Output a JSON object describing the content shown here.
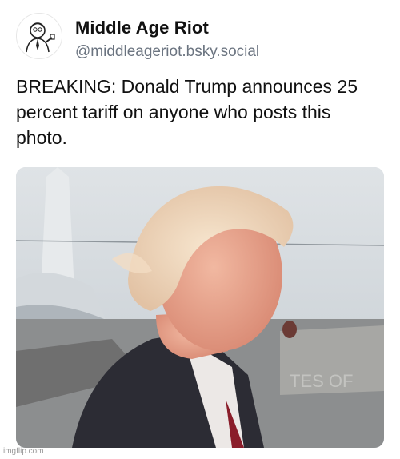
{
  "post": {
    "author": {
      "display_name": "Middle Age Riot",
      "handle": "@middleageriot.bsky.social",
      "avatar_icon": "caricature-avatar"
    },
    "text": "BREAKING: Donald Trump announces 25 percent tariff on anyone who posts this photo.",
    "image": {
      "description_icon": "photo",
      "background_text": "TES OF"
    }
  },
  "watermark": "imgflip.com",
  "colors": {
    "text": "#111111",
    "handle": "#6b7480",
    "watermark": "#9a9a9a"
  }
}
